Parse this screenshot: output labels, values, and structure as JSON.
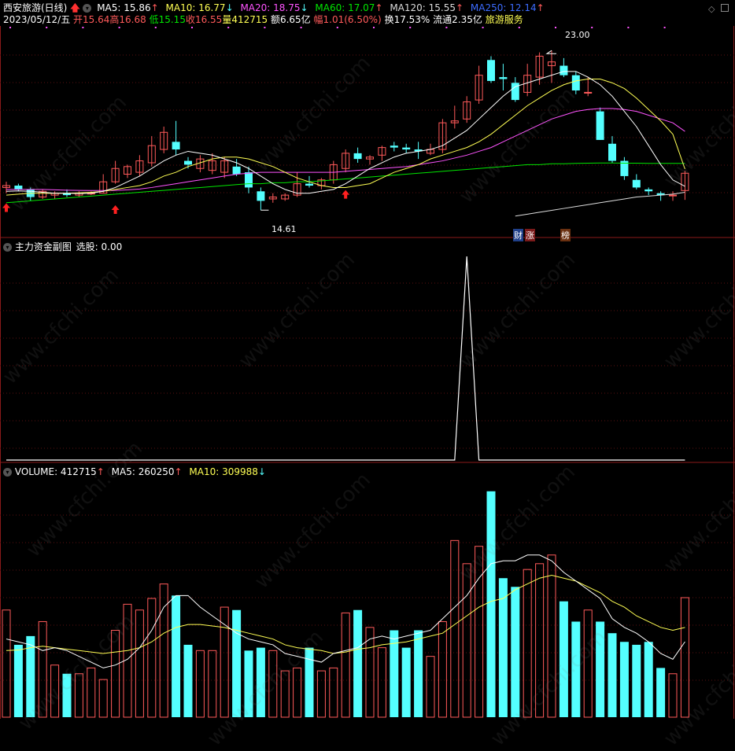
{
  "title": "西安旅游(日线)",
  "date": "2023/05/12/五",
  "ma_line": {
    "ma5": "MA5: 15.86",
    "ma10": "MA10: 16.77",
    "ma20": "MA20: 18.75",
    "ma60": "MA60: 17.07",
    "ma120": "MA120: 15.55",
    "ma250": "MA250: 12.14"
  },
  "quote": {
    "open": "开15.64",
    "high": "高16.68",
    "low": "低15.15",
    "close": "收16.55",
    "volume": "量412715",
    "amount": "额6.65亿",
    "change": "幅1.01(6.50%)",
    "turnover": "换17.53%",
    "float": "流通2.35亿",
    "sector": "旅游服务"
  },
  "annotations": {
    "high_price": "23.00",
    "low_price": "14.61",
    "tag_cai": "财",
    "tag_zhang": "涨",
    "tag_bang": "榜"
  },
  "sub_panel": {
    "title": "主力资金副图",
    "select": "选股: 0.00"
  },
  "volume_panel": {
    "volume": "VOLUME: 412715",
    "ma5": "MA5: 260250",
    "ma10": "MA10: 309988"
  },
  "watermark": "www.cfchi.com",
  "colors": {
    "up": "#ff5a5a",
    "down": "#54ffff",
    "ma5": "#ffffff",
    "ma10": "#ffff54",
    "ma20": "#ff54ff",
    "ma60": "#00e600",
    "ma120": "#dcdcdc",
    "ma250": "#3c6cff"
  },
  "chart_data": [
    {
      "type": "candlestick",
      "title": "西安旅游(日线)",
      "ylim": [
        14.0,
        24.0
      ],
      "candles": [
        {
          "o": 15.8,
          "h": 16.1,
          "l": 15.5,
          "c": 15.9
        },
        {
          "o": 15.9,
          "h": 16.0,
          "l": 15.6,
          "c": 15.7
        },
        {
          "o": 15.7,
          "h": 15.8,
          "l": 15.1,
          "c": 15.3
        },
        {
          "o": 15.3,
          "h": 15.7,
          "l": 15.2,
          "c": 15.6
        },
        {
          "o": 15.4,
          "h": 15.6,
          "l": 15.2,
          "c": 15.5
        },
        {
          "o": 15.5,
          "h": 15.7,
          "l": 15.3,
          "c": 15.4
        },
        {
          "o": 15.4,
          "h": 15.6,
          "l": 15.3,
          "c": 15.5
        },
        {
          "o": 15.5,
          "h": 15.6,
          "l": 15.4,
          "c": 15.5
        },
        {
          "o": 15.5,
          "h": 16.5,
          "l": 15.5,
          "c": 16.1
        },
        {
          "o": 16.1,
          "h": 17.2,
          "l": 16.0,
          "c": 16.8
        },
        {
          "o": 16.5,
          "h": 17.0,
          "l": 16.3,
          "c": 16.9
        },
        {
          "o": 16.6,
          "h": 17.5,
          "l": 16.4,
          "c": 17.2
        },
        {
          "o": 17.1,
          "h": 18.5,
          "l": 16.9,
          "c": 18.0
        },
        {
          "o": 17.8,
          "h": 19.0,
          "l": 17.6,
          "c": 18.7
        },
        {
          "o": 18.2,
          "h": 19.3,
          "l": 17.5,
          "c": 17.8
        },
        {
          "o": 17.2,
          "h": 17.4,
          "l": 16.8,
          "c": 17.0
        },
        {
          "o": 16.8,
          "h": 17.5,
          "l": 16.6,
          "c": 17.3
        },
        {
          "o": 16.7,
          "h": 17.6,
          "l": 16.5,
          "c": 17.2
        },
        {
          "o": 16.6,
          "h": 17.4,
          "l": 16.3,
          "c": 17.2
        },
        {
          "o": 16.9,
          "h": 17.3,
          "l": 16.4,
          "c": 16.5
        },
        {
          "o": 16.6,
          "h": 16.9,
          "l": 15.5,
          "c": 15.8
        },
        {
          "o": 15.6,
          "h": 15.8,
          "l": 14.61,
          "c": 15.1
        },
        {
          "o": 15.2,
          "h": 15.5,
          "l": 15.0,
          "c": 15.3
        },
        {
          "o": 15.2,
          "h": 15.5,
          "l": 15.1,
          "c": 15.4
        },
        {
          "o": 15.4,
          "h": 16.6,
          "l": 15.3,
          "c": 16.0
        },
        {
          "o": 16.0,
          "h": 16.4,
          "l": 15.8,
          "c": 15.9
        },
        {
          "o": 15.9,
          "h": 16.3,
          "l": 15.7,
          "c": 16.2
        },
        {
          "o": 16.2,
          "h": 17.2,
          "l": 16.0,
          "c": 17.0
        },
        {
          "o": 16.8,
          "h": 17.8,
          "l": 16.6,
          "c": 17.6
        },
        {
          "o": 17.6,
          "h": 17.9,
          "l": 17.1,
          "c": 17.3
        },
        {
          "o": 17.3,
          "h": 17.5,
          "l": 17.0,
          "c": 17.4
        },
        {
          "o": 17.5,
          "h": 18.0,
          "l": 17.2,
          "c": 17.9
        },
        {
          "o": 18.0,
          "h": 18.2,
          "l": 17.7,
          "c": 17.9
        },
        {
          "o": 17.9,
          "h": 18.1,
          "l": 17.6,
          "c": 17.8
        },
        {
          "o": 17.8,
          "h": 18.2,
          "l": 17.3,
          "c": 17.7
        },
        {
          "o": 17.6,
          "h": 18.1,
          "l": 17.5,
          "c": 17.8
        },
        {
          "o": 17.8,
          "h": 19.4,
          "l": 17.6,
          "c": 19.2
        },
        {
          "o": 19.2,
          "h": 20.1,
          "l": 18.9,
          "c": 19.3
        },
        {
          "o": 19.4,
          "h": 20.6,
          "l": 19.2,
          "c": 20.3
        },
        {
          "o": 20.4,
          "h": 22.2,
          "l": 20.2,
          "c": 21.7
        },
        {
          "o": 22.5,
          "h": 22.7,
          "l": 21.3,
          "c": 21.4
        },
        {
          "o": 21.6,
          "h": 22.3,
          "l": 20.9,
          "c": 21.5
        },
        {
          "o": 21.3,
          "h": 21.6,
          "l": 20.3,
          "c": 20.4
        },
        {
          "o": 20.8,
          "h": 22.3,
          "l": 20.6,
          "c": 21.7
        },
        {
          "o": 21.6,
          "h": 22.9,
          "l": 21.2,
          "c": 22.7
        },
        {
          "o": 22.2,
          "h": 23.0,
          "l": 21.3,
          "c": 22.4
        },
        {
          "o": 22.2,
          "h": 22.6,
          "l": 21.6,
          "c": 21.7
        },
        {
          "o": 21.7,
          "h": 21.9,
          "l": 20.7,
          "c": 20.9
        },
        {
          "o": 20.8,
          "h": 21.6,
          "l": 20.6,
          "c": 20.8
        },
        {
          "o": 19.8,
          "h": 20.0,
          "l": 18.3,
          "c": 18.3
        },
        {
          "o": 18.1,
          "h": 18.5,
          "l": 17.1,
          "c": 17.2
        },
        {
          "o": 17.2,
          "h": 17.4,
          "l": 16.2,
          "c": 16.4
        },
        {
          "o": 16.2,
          "h": 16.5,
          "l": 15.7,
          "c": 15.8
        },
        {
          "o": 15.7,
          "h": 15.8,
          "l": 15.4,
          "c": 15.6
        },
        {
          "o": 15.5,
          "h": 15.6,
          "l": 15.1,
          "c": 15.4
        },
        {
          "o": 15.4,
          "h": 15.6,
          "l": 15.1,
          "c": 15.4
        },
        {
          "o": 15.64,
          "h": 16.68,
          "l": 15.15,
          "c": 16.55
        }
      ],
      "ma5": [
        15.6,
        15.62,
        15.6,
        15.55,
        15.5,
        15.5,
        15.48,
        15.5,
        15.6,
        15.8,
        16.1,
        16.4,
        16.8,
        17.2,
        17.5,
        17.7,
        17.6,
        17.5,
        17.3,
        17.1,
        16.8,
        16.4,
        16.0,
        15.7,
        15.5,
        15.5,
        15.6,
        15.7,
        16.0,
        16.4,
        16.8,
        17.1,
        17.4,
        17.6,
        17.7,
        17.8,
        18.0,
        18.4,
        18.8,
        19.4,
        20.0,
        20.6,
        21.1,
        21.3,
        21.5,
        21.7,
        21.9,
        21.9,
        21.6,
        21.2,
        20.6,
        19.8,
        19.0,
        18.0,
        17.0,
        16.2,
        15.86
      ],
      "ma10": [
        15.4,
        15.45,
        15.5,
        15.5,
        15.5,
        15.5,
        15.52,
        15.55,
        15.6,
        15.7,
        15.8,
        15.9,
        16.1,
        16.4,
        16.6,
        16.9,
        17.1,
        17.3,
        17.4,
        17.4,
        17.3,
        17.1,
        16.9,
        16.6,
        16.3,
        16.1,
        15.9,
        15.8,
        15.8,
        15.9,
        16.0,
        16.3,
        16.6,
        16.8,
        17.0,
        17.3,
        17.5,
        17.7,
        17.9,
        18.2,
        18.6,
        19.1,
        19.6,
        20.1,
        20.5,
        20.9,
        21.2,
        21.4,
        21.5,
        21.5,
        21.3,
        21.0,
        20.5,
        19.9,
        19.3,
        18.6,
        16.77
      ],
      "ma20": [
        15.7,
        15.7,
        15.7,
        15.7,
        15.68,
        15.66,
        15.65,
        15.64,
        15.64,
        15.65,
        15.68,
        15.72,
        15.8,
        15.9,
        16.0,
        16.1,
        16.2,
        16.3,
        16.4,
        16.5,
        16.55,
        16.6,
        16.6,
        16.6,
        16.6,
        16.6,
        16.6,
        16.6,
        16.65,
        16.7,
        16.75,
        16.8,
        16.85,
        16.9,
        17.0,
        17.1,
        17.2,
        17.35,
        17.5,
        17.7,
        17.9,
        18.2,
        18.5,
        18.8,
        19.1,
        19.4,
        19.6,
        19.8,
        19.9,
        19.95,
        19.95,
        19.9,
        19.8,
        19.6,
        19.4,
        19.2,
        18.75
      ],
      "ma60": [
        15.0,
        15.05,
        15.1,
        15.15,
        15.2,
        15.25,
        15.3,
        15.35,
        15.4,
        15.45,
        15.5,
        15.55,
        15.6,
        15.65,
        15.7,
        15.75,
        15.8,
        15.85,
        15.9,
        15.95,
        16.0,
        16.0,
        16.05,
        16.05,
        16.1,
        16.1,
        16.15,
        16.2,
        16.25,
        16.3,
        16.35,
        16.4,
        16.45,
        16.5,
        16.55,
        16.6,
        16.65,
        16.7,
        16.75,
        16.8,
        16.85,
        16.9,
        16.95,
        17.0,
        17.0,
        17.05,
        17.05,
        17.07,
        17.08,
        17.09,
        17.09,
        17.08,
        17.08,
        17.07,
        17.07,
        17.07,
        17.07
      ],
      "ma120": [
        null,
        null,
        null,
        null,
        null,
        null,
        null,
        null,
        null,
        null,
        null,
        null,
        null,
        null,
        null,
        null,
        null,
        null,
        null,
        null,
        null,
        null,
        null,
        null,
        null,
        null,
        null,
        null,
        null,
        null,
        null,
        null,
        null,
        null,
        null,
        null,
        null,
        null,
        null,
        null,
        null,
        null,
        14.3,
        14.4,
        14.5,
        14.6,
        14.7,
        14.8,
        14.9,
        15.0,
        15.1,
        15.2,
        15.3,
        15.35,
        15.4,
        15.45,
        15.55
      ]
    },
    {
      "type": "line",
      "title": "主力资金副图",
      "ylim": [
        0,
        1
      ],
      "values": [
        0,
        0,
        0,
        0,
        0,
        0,
        0,
        0,
        0,
        0,
        0,
        0,
        0,
        0,
        0,
        0,
        0,
        0,
        0,
        0,
        0,
        0,
        0,
        0,
        0,
        0,
        0,
        0,
        0,
        0,
        0,
        0,
        0,
        0,
        0,
        0,
        0,
        0,
        1,
        0,
        0,
        0,
        0,
        0,
        0,
        0,
        0,
        0,
        0,
        0,
        0,
        0,
        0,
        0,
        0,
        0,
        0
      ]
    },
    {
      "type": "bar",
      "title": "VOLUME",
      "ylim": [
        0,
        820000
      ],
      "values": [
        370000,
        250000,
        280000,
        330000,
        180000,
        150000,
        150000,
        170000,
        130000,
        300000,
        390000,
        370000,
        410000,
        460000,
        420000,
        250000,
        230000,
        230000,
        380000,
        370000,
        230000,
        240000,
        230000,
        160000,
        170000,
        240000,
        160000,
        170000,
        360000,
        370000,
        310000,
        240000,
        300000,
        240000,
        300000,
        210000,
        330000,
        610000,
        530000,
        590000,
        780000,
        480000,
        450000,
        510000,
        530000,
        560000,
        400000,
        330000,
        370000,
        330000,
        290000,
        260000,
        250000,
        260000,
        170000,
        150000,
        412715
      ],
      "ma5": [
        270000,
        260000,
        250000,
        230000,
        240000,
        230000,
        210000,
        190000,
        170000,
        180000,
        200000,
        240000,
        300000,
        380000,
        420000,
        420000,
        380000,
        350000,
        320000,
        290000,
        270000,
        260000,
        250000,
        220000,
        210000,
        200000,
        190000,
        220000,
        230000,
        240000,
        270000,
        280000,
        270000,
        280000,
        290000,
        300000,
        340000,
        380000,
        420000,
        480000,
        530000,
        540000,
        540000,
        560000,
        560000,
        540000,
        500000,
        470000,
        440000,
        410000,
        340000,
        310000,
        290000,
        260000,
        220000,
        200000,
        260250
      ],
      "ma10": [
        230000,
        232000,
        240000,
        245000,
        240000,
        235000,
        230000,
        225000,
        220000,
        225000,
        230000,
        240000,
        260000,
        290000,
        310000,
        320000,
        320000,
        315000,
        310000,
        300000,
        290000,
        280000,
        270000,
        250000,
        240000,
        235000,
        230000,
        220000,
        225000,
        235000,
        240000,
        250000,
        255000,
        260000,
        270000,
        280000,
        290000,
        320000,
        350000,
        380000,
        400000,
        410000,
        440000,
        460000,
        480000,
        490000,
        480000,
        470000,
        450000,
        430000,
        400000,
        380000,
        350000,
        330000,
        310000,
        300000,
        309988
      ]
    }
  ]
}
